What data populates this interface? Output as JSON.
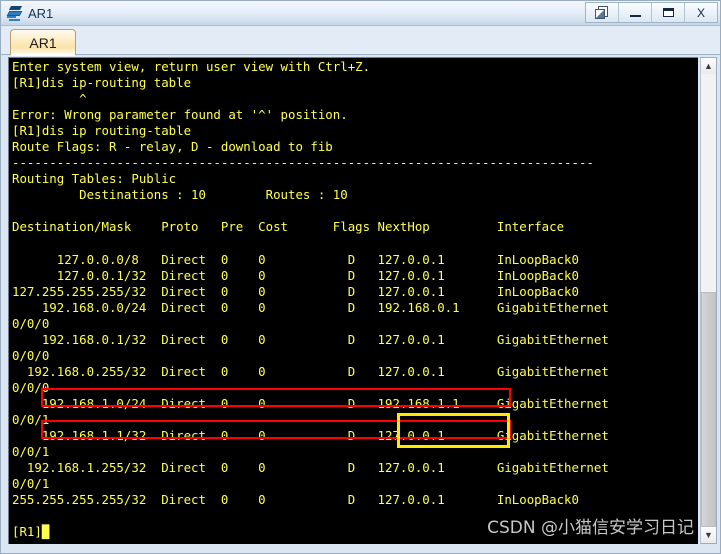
{
  "window": {
    "title": "AR1",
    "icon": "switch-icon",
    "controls": {
      "cascade_label": "",
      "minimize_label": "",
      "maximize_label": "",
      "close_label": "X"
    }
  },
  "tabs": [
    {
      "label": "AR1",
      "active": true
    }
  ],
  "terminal": {
    "fg_color": "#ffff4d",
    "bg_color": "#000000",
    "lines": [
      "Enter system view, return user view with Ctrl+Z.",
      "[R1]dis ip-routing table",
      "         ^",
      "Error: Wrong parameter found at '^' position.",
      "[R1]dis ip routing-table",
      "Route Flags: R - relay, D - download to fib",
      "------------------------------------------------------------------------------",
      "Routing Tables: Public",
      "         Destinations : 10        Routes : 10",
      "",
      "Destination/Mask    Proto   Pre  Cost      Flags NextHop         Interface",
      "",
      "      127.0.0.0/8   Direct  0    0           D   127.0.0.1       InLoopBack0",
      "      127.0.0.1/32  Direct  0    0           D   127.0.0.1       InLoopBack0",
      "127.255.255.255/32  Direct  0    0           D   127.0.0.1       InLoopBack0",
      "    192.168.0.0/24  Direct  0    0           D   192.168.0.1     GigabitEthernet",
      "0/0/0",
      "    192.168.0.1/32  Direct  0    0           D   127.0.0.1       GigabitEthernet",
      "0/0/0",
      "  192.168.0.255/32  Direct  0    0           D   127.0.0.1       GigabitEthernet",
      "0/0/0",
      "    192.168.1.0/24  Direct  0    0           D   192.168.1.1     GigabitEthernet",
      "0/0/1",
      "    192.168.1.1/32  Direct  0    0           D   127.0.0.1       GigabitEthernet",
      "0/0/1",
      "  192.168.1.255/32  Direct  0    0           D   127.0.0.1       GigabitEthernet",
      "0/0/1",
      "255.255.255.255/32  Direct  0    0           D   127.0.0.1       InLoopBack0",
      "",
      "[R1]"
    ],
    "prompt": "[R1]",
    "cursor_visible": true,
    "session_info": {
      "enter_message": "Enter system view, return user view with Ctrl+Z.",
      "error_message": "Error: Wrong parameter found at '^' position.",
      "route_flags": "Route Flags: R - relay, D - download to fib",
      "routing_tables": "Routing Tables: Public",
      "destinations_label": "Destinations",
      "destinations_count": "10",
      "routes_label": "Routes",
      "routes_count": "10",
      "commands": [
        "dis ip-routing table",
        "dis ip routing-table"
      ]
    },
    "route_table": {
      "columns": [
        "Destination/Mask",
        "Proto",
        "Pre",
        "Cost",
        "Flags",
        "NextHop",
        "Interface"
      ],
      "rows": [
        {
          "dest": "127.0.0.0/8",
          "proto": "Direct",
          "pre": "0",
          "cost": "0",
          "flags": "D",
          "nexthop": "127.0.0.1",
          "interface": "InLoopBack0"
        },
        {
          "dest": "127.0.0.1/32",
          "proto": "Direct",
          "pre": "0",
          "cost": "0",
          "flags": "D",
          "nexthop": "127.0.0.1",
          "interface": "InLoopBack0"
        },
        {
          "dest": "127.255.255.255/32",
          "proto": "Direct",
          "pre": "0",
          "cost": "0",
          "flags": "D",
          "nexthop": "127.0.0.1",
          "interface": "InLoopBack0"
        },
        {
          "dest": "192.168.0.0/24",
          "proto": "Direct",
          "pre": "0",
          "cost": "0",
          "flags": "D",
          "nexthop": "192.168.0.1",
          "interface": "GigabitEthernet0/0/0"
        },
        {
          "dest": "192.168.0.1/32",
          "proto": "Direct",
          "pre": "0",
          "cost": "0",
          "flags": "D",
          "nexthop": "127.0.0.1",
          "interface": "GigabitEthernet0/0/0"
        },
        {
          "dest": "192.168.0.255/32",
          "proto": "Direct",
          "pre": "0",
          "cost": "0",
          "flags": "D",
          "nexthop": "127.0.0.1",
          "interface": "GigabitEthernet0/0/0"
        },
        {
          "dest": "192.168.1.0/24",
          "proto": "Direct",
          "pre": "0",
          "cost": "0",
          "flags": "D",
          "nexthop": "192.168.1.1",
          "interface": "GigabitEthernet0/0/1"
        },
        {
          "dest": "192.168.1.1/32",
          "proto": "Direct",
          "pre": "0",
          "cost": "0",
          "flags": "D",
          "nexthop": "127.0.0.1",
          "interface": "GigabitEthernet0/0/1"
        },
        {
          "dest": "192.168.1.255/32",
          "proto": "Direct",
          "pre": "0",
          "cost": "0",
          "flags": "D",
          "nexthop": "127.0.0.1",
          "interface": "GigabitEthernet0/0/1"
        },
        {
          "dest": "255.255.255.255/32",
          "proto": "Direct",
          "pre": "0",
          "cost": "0",
          "flags": "D",
          "nexthop": "127.0.0.1",
          "interface": "InLoopBack0"
        }
      ]
    }
  },
  "annotations": {
    "red_box_1": {
      "color": "#ff0000",
      "target": "192.168.1.0/24 route row"
    },
    "red_box_2": {
      "color": "#ff0000",
      "target": "192.168.1.1/32 route row"
    },
    "yellow_box": {
      "color": "#ffeb00",
      "target": "127.0.0.1 nexthop of 192.168.1.1/32"
    }
  },
  "watermark": {
    "text": "CSDN @小猫信安学习日记",
    "color": "#d9d9d9"
  },
  "scrollbar": {
    "up_arrow": "▲",
    "down_arrow": "▼",
    "thumb_position": "bottom-half"
  }
}
